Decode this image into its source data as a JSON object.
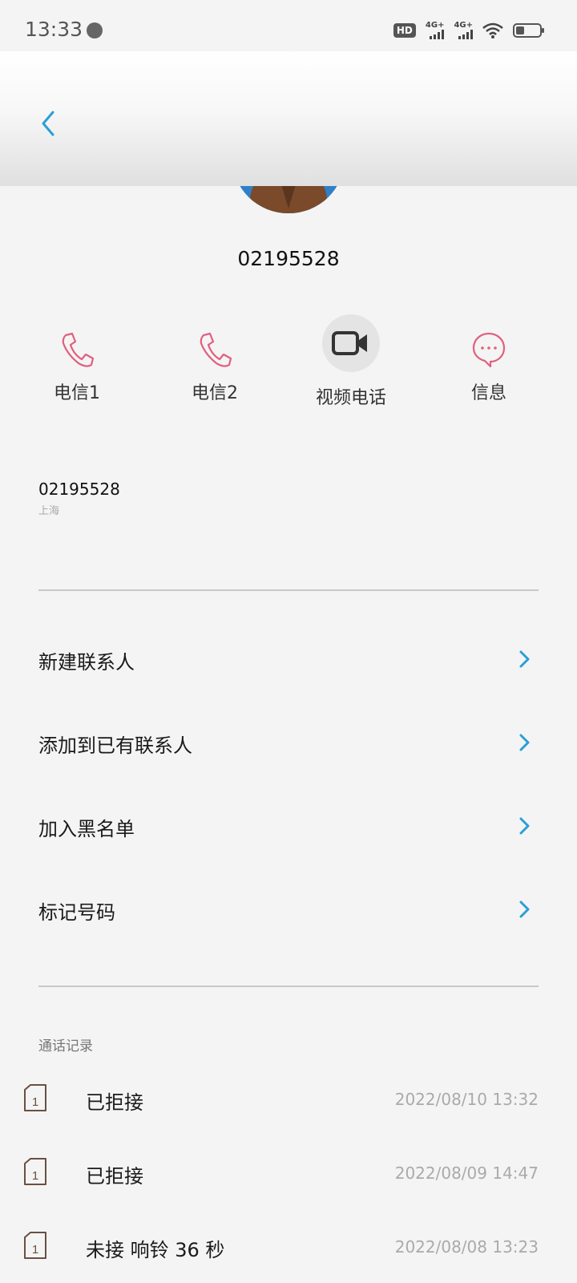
{
  "status_bar": {
    "time": "13:33",
    "hd": "HD",
    "sim1_network": "4G+",
    "sim2_network": "4G+"
  },
  "contact": {
    "number": "02195528"
  },
  "actions": [
    {
      "label": "电信1",
      "icon": "phone-icon",
      "color": "#e0607e"
    },
    {
      "label": "电信2",
      "icon": "phone-icon",
      "color": "#e0607e"
    },
    {
      "label": "视频电话",
      "icon": "video-camera-icon",
      "color": "#333333"
    },
    {
      "label": "信息",
      "icon": "message-bubble-icon",
      "color": "#e0607e"
    }
  ],
  "number_info": {
    "number": "02195528",
    "location": "上海"
  },
  "menu": [
    {
      "label": "新建联系人"
    },
    {
      "label": "添加到已有联系人"
    },
    {
      "label": "加入黑名单"
    },
    {
      "label": "标记号码"
    }
  ],
  "call_log": {
    "title": "通话记录",
    "entries": [
      {
        "sim": "1",
        "status": "已拒接",
        "time": "2022/08/10  13:32"
      },
      {
        "sim": "1",
        "status": "已拒接",
        "time": "2022/08/09  14:47"
      },
      {
        "sim": "1",
        "status": "未接 响铃 36 秒",
        "time": "2022/08/08  13:23"
      }
    ]
  },
  "colors": {
    "accent": "#2a9fd6",
    "pink": "#e0607e"
  }
}
